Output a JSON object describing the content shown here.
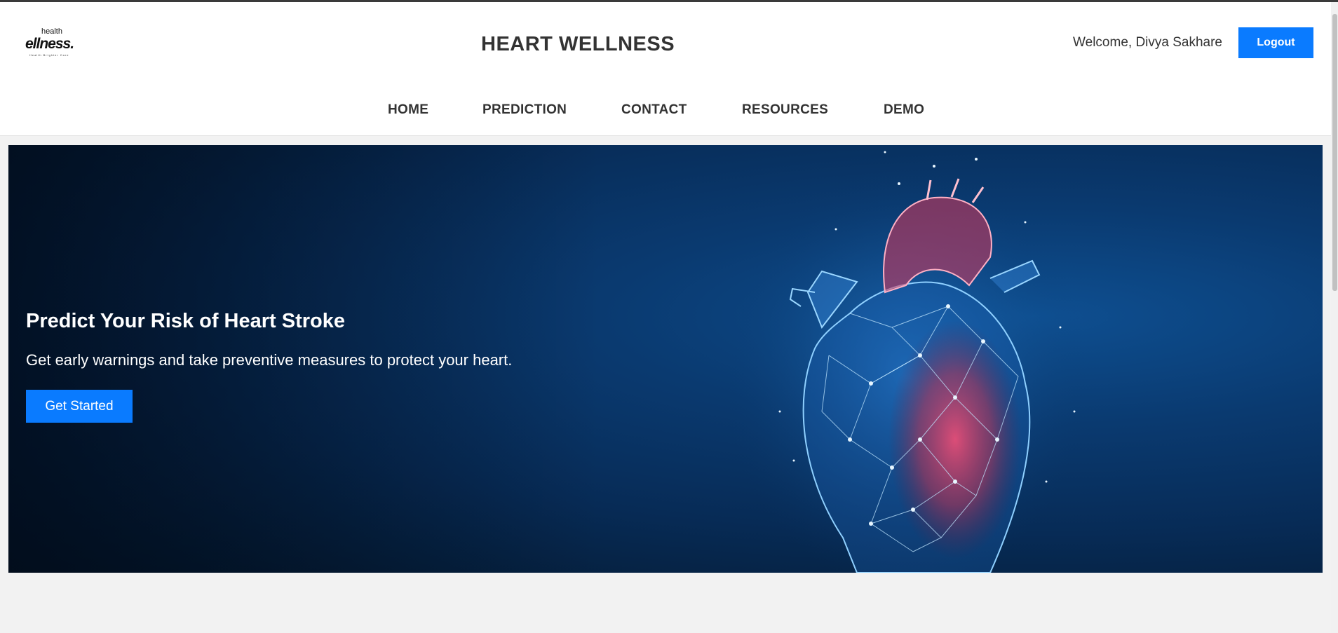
{
  "header": {
    "logo_small": "health",
    "logo_main": "ellness.",
    "logo_tagline": "Health Brighter Care",
    "site_title": "HEART WELLNESS",
    "welcome": "Welcome, Divya Sakhare",
    "logout_label": "Logout"
  },
  "nav": {
    "items": [
      {
        "label": "HOME"
      },
      {
        "label": "PREDICTION"
      },
      {
        "label": "CONTACT"
      },
      {
        "label": "RESOURCES"
      },
      {
        "label": "DEMO"
      }
    ]
  },
  "hero": {
    "title": "Predict Your Risk of Heart Stroke",
    "subtitle": "Get early warnings and take preventive measures to protect your heart.",
    "cta_label": "Get Started",
    "image": "wireframe-heart-illustration"
  },
  "colors": {
    "accent": "#0a7bff",
    "hero_bg": "#072b56",
    "heart_glow": "#e23a5e"
  }
}
